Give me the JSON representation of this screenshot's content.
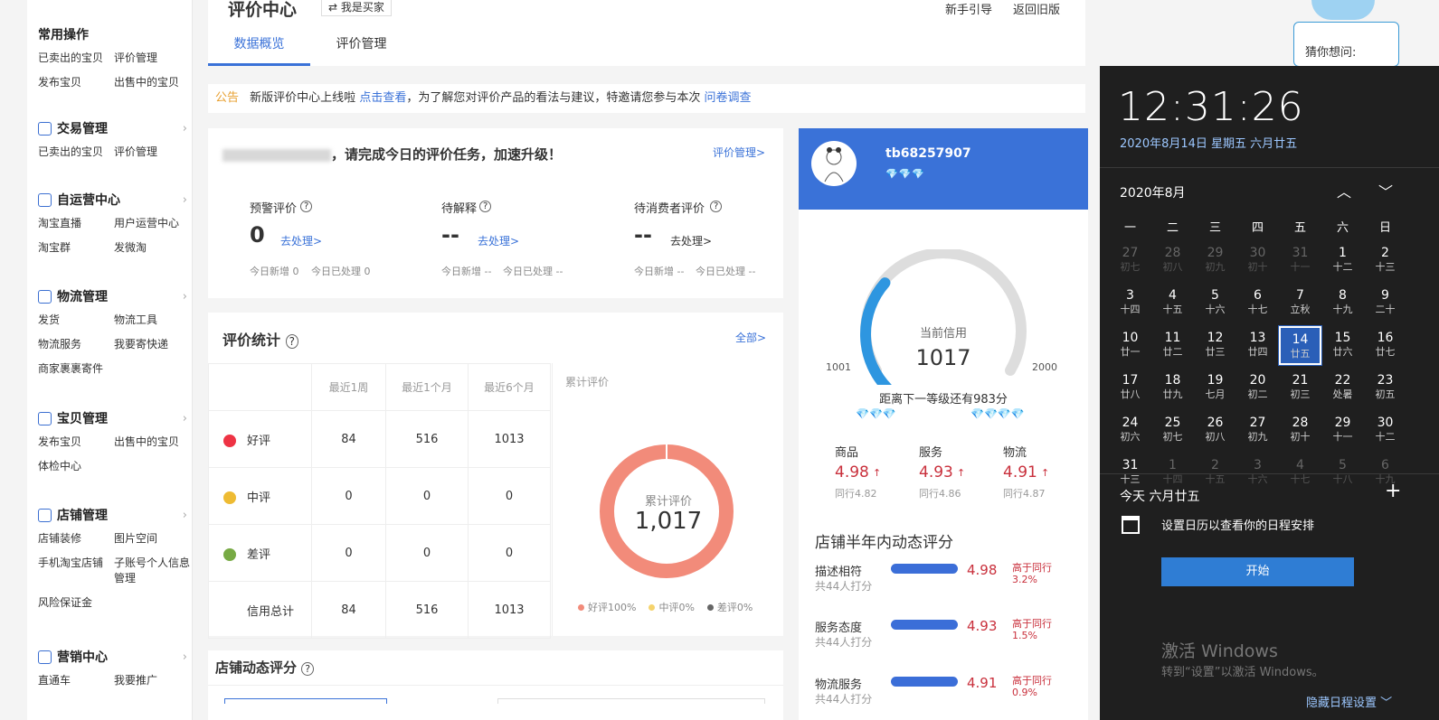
{
  "sidebar": {
    "sections": [
      {
        "title": "常用操作",
        "icon": "",
        "links": [
          "已卖出的宝贝",
          "评价管理",
          "发布宝贝",
          "出售中的宝贝"
        ]
      },
      {
        "title": "交易管理",
        "icon": "trade-icon",
        "links": [
          "已卖出的宝贝",
          "评价管理"
        ]
      },
      {
        "title": "自运营中心",
        "icon": "chat-icon",
        "links": [
          "淘宝直播",
          "用户运营中心",
          "淘宝群",
          "发微淘"
        ]
      },
      {
        "title": "物流管理",
        "icon": "truck-icon",
        "links": [
          "发货",
          "物流工具",
          "物流服务",
          "我要寄快递",
          "商家裹裹寄件"
        ]
      },
      {
        "title": "宝贝管理",
        "icon": "goods-icon",
        "links": [
          "发布宝贝",
          "出售中的宝贝",
          "体检中心"
        ]
      },
      {
        "title": "店铺管理",
        "icon": "shop-icon",
        "links": [
          "店铺装修",
          "图片空间",
          "手机淘宝店铺",
          "子账号个人信息管理",
          "风险保证金"
        ]
      },
      {
        "title": "营销中心",
        "icon": "megaphone-icon",
        "links": [
          "直通车",
          "我要推广"
        ]
      }
    ]
  },
  "header": {
    "title": "评价中心",
    "role_switch": "⇄ 我是买家",
    "guide": "新手引导",
    "back_old": "返回旧版",
    "tabs": [
      "数据概览",
      "评价管理"
    ]
  },
  "notice": {
    "tag": "公告",
    "text1": "新版评价中心上线啦",
    "link1": "点击查看",
    "text2": "，为了解您对评价产品的看法与建议，特邀请您参与本次",
    "link2": "问卷调查"
  },
  "task": {
    "greeting": "，请完成今日的评价任务，加速升级！",
    "manage_link": "评价管理>",
    "items": [
      {
        "label": "预警评价",
        "value": "0",
        "action": "去处理>",
        "new": "今日新增 0",
        "done": "今日已处理 0"
      },
      {
        "label": "待解释",
        "value": "--",
        "action": "去处理>",
        "new": "今日新增 --",
        "done": "今日已处理 --"
      },
      {
        "label": "待消费者评价",
        "value": "--",
        "action": "去处理>",
        "new": "今日新增 --",
        "done": "今日已处理 --"
      }
    ]
  },
  "stats": {
    "title": "评价统计",
    "all_link": "全部>",
    "headers": [
      "最近1周",
      "最近1个月",
      "最近6个月"
    ],
    "rows": [
      {
        "label": "好评",
        "icon": "flower-icon",
        "values": [
          "84",
          "516",
          "1013"
        ]
      },
      {
        "label": "中评",
        "icon": "flower-icon",
        "values": [
          "0",
          "0",
          "0"
        ]
      },
      {
        "label": "差评",
        "icon": "wilted-icon",
        "values": [
          "0",
          "0",
          "0"
        ]
      },
      {
        "label": "信用总计",
        "icon": "",
        "values": [
          "84",
          "516",
          "1013"
        ]
      }
    ],
    "donut_title": "累计评价",
    "donut_label": "累计评价",
    "donut_value": "1,017",
    "legend": [
      "好评100%",
      "中评0%",
      "差评0%"
    ],
    "colors": {
      "good": "#f28b7a",
      "mid": "#f5d36c",
      "bad": "#666666"
    }
  },
  "dynamic_title": "店铺动态评分",
  "profile": {
    "username": "tb68257907",
    "credit_label": "当前信用",
    "credit_value": "1017",
    "min": "1001",
    "max": "2000",
    "progress": 0.02,
    "next_level": "距离下一等级还有983分",
    "scores": [
      {
        "label": "商品",
        "value": "4.98",
        "peer": "同行4.82"
      },
      {
        "label": "服务",
        "value": "4.93",
        "peer": "同行4.86"
      },
      {
        "label": "物流",
        "value": "4.91",
        "peer": "同行4.87"
      }
    ],
    "half_year_title": "店铺半年内动态评分",
    "half_year": [
      {
        "label": "描述相符",
        "sub": "共44人打分",
        "value": "4.98",
        "cmp": "高于同行",
        "pct": "3.2%"
      },
      {
        "label": "服务态度",
        "sub": "共44人打分",
        "value": "4.93",
        "cmp": "高于同行",
        "pct": "1.5%"
      },
      {
        "label": "物流服务",
        "sub": "共44人打分",
        "value": "4.91",
        "cmp": "高于同行",
        "pct": "0.9%"
      }
    ]
  },
  "assistant": {
    "prompt": "猜你想问:"
  },
  "calendar": {
    "time": "12:31:26",
    "date": "2020年8月14日 星期五 六月廿五",
    "month": "2020年8月",
    "weekdays": [
      "一",
      "二",
      "三",
      "四",
      "五",
      "六",
      "日"
    ],
    "days": [
      [
        "27",
        "初七",
        1
      ],
      [
        "28",
        "初八",
        1
      ],
      [
        "29",
        "初九",
        1
      ],
      [
        "30",
        "初十",
        1
      ],
      [
        "31",
        "十一",
        1
      ],
      [
        "1",
        "十二",
        0
      ],
      [
        "2",
        "十三",
        0
      ],
      [
        "3",
        "十四",
        0
      ],
      [
        "4",
        "十五",
        0
      ],
      [
        "5",
        "十六",
        0
      ],
      [
        "6",
        "十七",
        0
      ],
      [
        "7",
        "立秋",
        0
      ],
      [
        "8",
        "十九",
        0
      ],
      [
        "9",
        "二十",
        0
      ],
      [
        "10",
        "廿一",
        0
      ],
      [
        "11",
        "廿二",
        0
      ],
      [
        "12",
        "廿三",
        0
      ],
      [
        "13",
        "廿四",
        0
      ],
      [
        "14",
        "廿五",
        2
      ],
      [
        "15",
        "廿六",
        0
      ],
      [
        "16",
        "廿七",
        0
      ],
      [
        "17",
        "廿八",
        0
      ],
      [
        "18",
        "廿九",
        0
      ],
      [
        "19",
        "七月",
        0
      ],
      [
        "20",
        "初二",
        0
      ],
      [
        "21",
        "初三",
        0
      ],
      [
        "22",
        "处暑",
        0
      ],
      [
        "23",
        "初五",
        0
      ],
      [
        "24",
        "初六",
        0
      ],
      [
        "25",
        "初七",
        0
      ],
      [
        "26",
        "初八",
        0
      ],
      [
        "27",
        "初九",
        0
      ],
      [
        "28",
        "初十",
        0
      ],
      [
        "29",
        "十一",
        0
      ],
      [
        "30",
        "十二",
        0
      ],
      [
        "31",
        "十三",
        0
      ],
      [
        "1",
        "十四",
        1
      ],
      [
        "2",
        "十五",
        1
      ],
      [
        "3",
        "十六",
        1
      ],
      [
        "4",
        "十七",
        1
      ],
      [
        "5",
        "十八",
        1
      ],
      [
        "6",
        "十九",
        1
      ]
    ],
    "today_label": "今天 六月廿五",
    "event_hint": "设置日历以查看你的日程安排",
    "start_button": "开始",
    "watermark_title": "激活 Windows",
    "watermark_sub": "转到“设置”以激活 Windows。",
    "hide_schedule": "隐藏日程设置"
  }
}
